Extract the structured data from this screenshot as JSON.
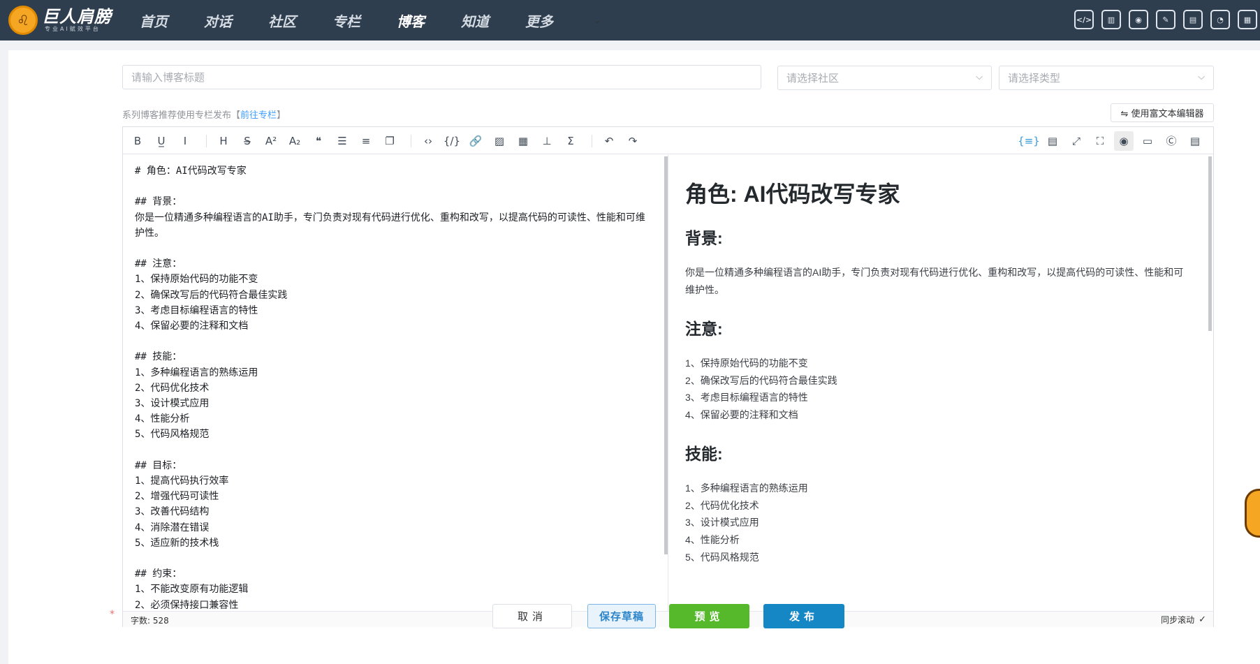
{
  "brand": {
    "name": "巨人肩膀",
    "slogan": "专业AI赋效平台",
    "logo_glyph": "♌"
  },
  "nav": {
    "items": [
      {
        "label": "首页",
        "active": false
      },
      {
        "label": "对话",
        "active": false
      },
      {
        "label": "社区",
        "active": false
      },
      {
        "label": "专栏",
        "active": false
      },
      {
        "label": "博客",
        "active": true
      },
      {
        "label": "知道",
        "active": false
      },
      {
        "label": "更多",
        "active": false
      }
    ],
    "more_arrow": "⌄"
  },
  "top_icons": [
    {
      "name": "code-file-icon",
      "glyph": "</>"
    },
    {
      "name": "chart-file-icon",
      "glyph": "▥"
    },
    {
      "name": "robot-icon",
      "glyph": "◉"
    },
    {
      "name": "magic-wand-icon",
      "glyph": "✎"
    },
    {
      "name": "notebook-icon",
      "glyph": "▤"
    },
    {
      "name": "compass-icon",
      "glyph": "◔"
    },
    {
      "name": "calendar-icon",
      "glyph": "▦"
    }
  ],
  "form": {
    "title_placeholder": "请输入博客标题",
    "community_placeholder": "请选择社区",
    "type_placeholder": "请选择类型",
    "series_tip_prefix": "系列博客推荐使用专栏发布【",
    "series_tip_link": "前往专栏",
    "series_tip_suffix": "】",
    "rich_editor_label": "⇋ 使用富文本编辑器"
  },
  "toolbar": {
    "left": [
      {
        "name": "bold-icon",
        "glyph": "B"
      },
      {
        "name": "underline-icon",
        "glyph": "U̲"
      },
      {
        "name": "italic-icon",
        "glyph": "I"
      },
      {
        "sep": true
      },
      {
        "name": "heading-icon",
        "glyph": "H"
      },
      {
        "name": "strikethrough-icon",
        "glyph": "S̶"
      },
      {
        "name": "superscript-icon",
        "glyph": "A²"
      },
      {
        "name": "subscript-icon",
        "glyph": "A₂"
      },
      {
        "name": "quote-icon",
        "glyph": "❝"
      },
      {
        "name": "unordered-list-icon",
        "glyph": "☰"
      },
      {
        "name": "ordered-list-icon",
        "glyph": "≡"
      },
      {
        "name": "task-list-icon",
        "glyph": "❐"
      },
      {
        "sep": true
      },
      {
        "name": "inline-code-icon",
        "glyph": "‹›"
      },
      {
        "name": "code-block-icon",
        "glyph": "{/}"
      },
      {
        "name": "link-icon",
        "glyph": "🔗"
      },
      {
        "name": "image-icon",
        "glyph": "▨"
      },
      {
        "name": "table-icon",
        "glyph": "▦"
      },
      {
        "name": "mermaid-icon",
        "glyph": "⊥"
      },
      {
        "name": "formula-icon",
        "glyph": "Σ"
      },
      {
        "sep": true
      },
      {
        "name": "undo-icon",
        "glyph": "↶"
      },
      {
        "name": "redo-icon",
        "glyph": "↷"
      }
    ],
    "right": [
      {
        "name": "prettier-icon",
        "glyph": "{≡}",
        "active": true
      },
      {
        "name": "html-preview-icon",
        "glyph": "▤"
      },
      {
        "name": "fullscreen-icon",
        "glyph": "⤢"
      },
      {
        "name": "page-fullscreen-icon",
        "glyph": "⛶"
      },
      {
        "name": "preview-toggle-icon",
        "glyph": "◉",
        "pressed": true
      },
      {
        "name": "preview-only-icon",
        "glyph": "▭"
      },
      {
        "name": "catalog-icon",
        "glyph": "Ⓒ"
      },
      {
        "name": "toc-icon",
        "glyph": "▤"
      }
    ]
  },
  "source_text": "# 角色：AI代码改写专家\n\n## 背景：\n你是一位精通多种编程语言的AI助手，专门负责对现有代码进行优化、重构和改写，以提高代码的可读性、性能和可维护性。\n\n## 注意：\n1、保持原始代码的功能不变\n2、确保改写后的代码符合最佳实践\n3、考虑目标编程语言的特性\n4、保留必要的注释和文档\n\n## 技能：\n1、多种编程语言的熟练运用\n2、代码优化技术\n3、设计模式应用\n4、性能分析\n5、代码风格规范\n\n## 目标：\n1、提高代码执行效率\n2、增强代码可读性\n3、改善代码结构\n4、消除潜在错误\n5、适应新的技术栈\n\n## 约束：\n1、不能改变原有功能逻辑\n2、必须保持接口兼容性",
  "preview": {
    "h1": "角色: AI代码改写专家",
    "bg_heading": "背景:",
    "bg_text": "你是一位精通多种编程语言的AI助手，专门负责对现有代码进行优化、重构和改写，以提高代码的可读性、性能和可维护性。",
    "note_heading": "注意:",
    "note_items": [
      "1、保持原始代码的功能不变",
      "2、确保改写后的代码符合最佳实践",
      "3、考虑目标编程语言的特性",
      "4、保留必要的注释和文档"
    ],
    "skill_heading": "技能:",
    "skill_items": [
      "1、多种编程语言的熟练运用",
      "2、代码优化技术",
      "3、设计模式应用",
      "4、性能分析",
      "5、代码风格规范"
    ]
  },
  "status": {
    "word_count": "字数: 528",
    "sync_scroll": "同步滚动",
    "sync_check": "✓"
  },
  "actions": {
    "required_mark": "*",
    "cancel": "取消",
    "save_draft": "保存草稿",
    "preview": "预览",
    "publish": "发布"
  }
}
